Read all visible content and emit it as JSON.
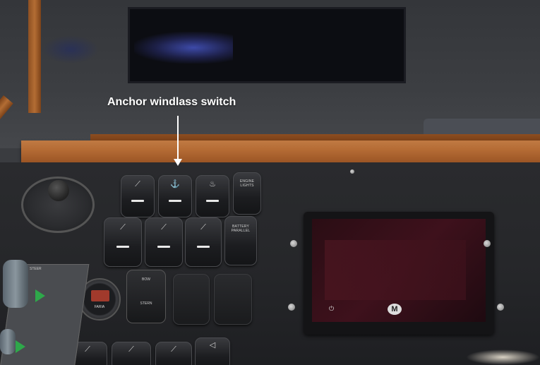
{
  "annotation": {
    "label": "Anchor windlass switch"
  },
  "switches": {
    "battery_parallel": "BATTERY PARALLEL",
    "engine_lights": "ENGINE LIGHTS",
    "stern": "STERN",
    "bow": "BOW"
  },
  "gauge": {
    "brand": "FARIA"
  },
  "joystick": {
    "label": "STEER"
  },
  "colors": {
    "annotation_text": "#ffffff",
    "joystick_arrow": "#2ea84a",
    "display_screen": "#3e111c",
    "wood": "#b56c35"
  }
}
